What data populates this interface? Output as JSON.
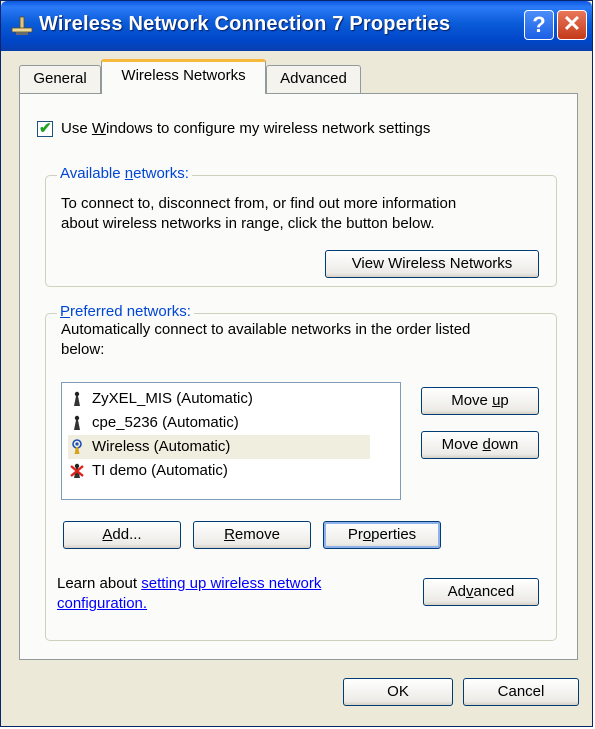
{
  "window": {
    "title": "Wireless Network Connection 7 Properties",
    "help_glyph": "?",
    "close_glyph": "✕"
  },
  "tabs": [
    {
      "label": "General",
      "active": false
    },
    {
      "label": "Wireless Networks",
      "active": true
    },
    {
      "label": "Advanced",
      "active": false
    }
  ],
  "use_windows": {
    "checked": true,
    "label_pre": "Use ",
    "label_acc": "W",
    "label_post": "indows to configure my wireless network settings"
  },
  "available": {
    "title_pre": "Available ",
    "title_acc": "n",
    "title_post": "etworks:",
    "desc_line1": "To connect to, disconnect from, or find out more information",
    "desc_line2": "about wireless networks in range, click the button below.",
    "view_button": "View Wireless Networks"
  },
  "preferred": {
    "title_acc": "P",
    "title_post": "referred networks:",
    "desc_line1": "Automatically connect to available networks in the order listed",
    "desc_line2": "below:",
    "networks": [
      {
        "label": "ZyXEL_MIS (Automatic)",
        "icon": "wireless-antenna-icon",
        "selected": false
      },
      {
        "label": "cpe_5236 (Automatic)",
        "icon": "wireless-antenna-icon",
        "selected": false
      },
      {
        "label": "Wireless (Automatic)",
        "icon": "wireless-connected-icon",
        "selected": true
      },
      {
        "label": "TI demo (Automatic)",
        "icon": "wireless-unavailable-icon",
        "selected": false
      }
    ],
    "move_up": {
      "pre": "Move ",
      "acc": "u",
      "post": "p"
    },
    "move_down": {
      "pre": "Move ",
      "acc": "d",
      "post": "own"
    },
    "add": {
      "acc": "A",
      "post": "dd..."
    },
    "remove": {
      "acc": "R",
      "post": "emove"
    },
    "properties": {
      "pre": "Pr",
      "acc": "o",
      "post": "perties"
    },
    "learn_pre": "Learn about ",
    "learn_link_line1": "setting up wireless network",
    "learn_link_line2": "configuration.",
    "advanced": {
      "pre": "Ad",
      "acc": "v",
      "post": "anced"
    }
  },
  "footer": {
    "ok": "OK",
    "cancel": "Cancel"
  },
  "colors": {
    "titlebar": "#0a5bd8",
    "link": "#0000ff",
    "group_title": "#0046d5",
    "check": "#21a121"
  }
}
